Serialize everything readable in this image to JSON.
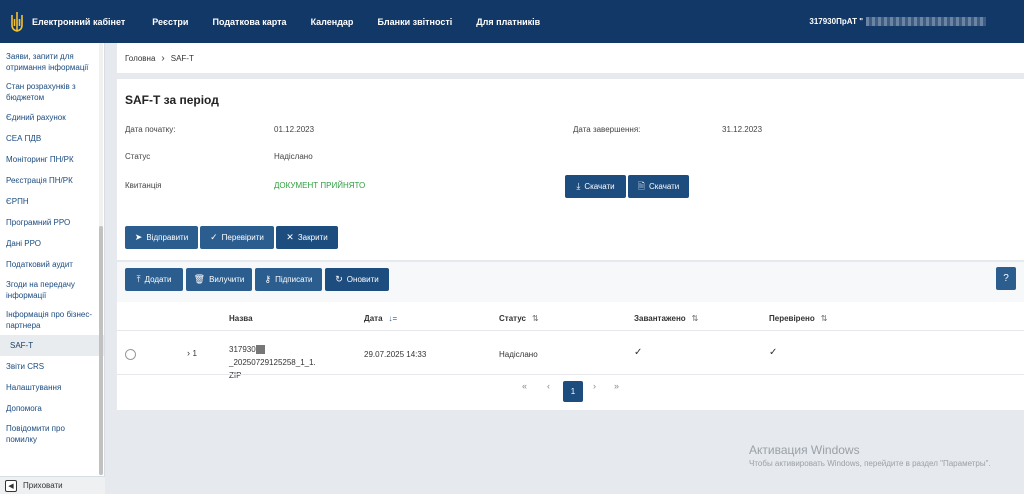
{
  "topbar": {
    "brand": "Електронний кабінет",
    "nav": [
      "Реєстри",
      "Податкова карта",
      "Календар",
      "Бланки звітності",
      "Для платників"
    ],
    "user": "317930",
    "user_suffix": "ПрАТ \""
  },
  "sidebar": {
    "items": [
      "Заяви, запити для отримання інформації",
      "Стан розрахунків з бюджетом",
      "Єдиний рахунок",
      "СЕА ПДВ",
      "Моніторинг ПН/РК",
      "Реєстрація ПН/РК",
      "ЄРПН",
      "Програмний РРО",
      "Дані РРО",
      "Податковий аудит",
      "Згоди на передачу інформації",
      "Інформація про бізнес-партнера",
      "SAF-T",
      "Звіти CRS",
      "Налаштування",
      "Допомога",
      "Повідомити про помилку"
    ],
    "active_item": "SAF-T",
    "hide_label": "Приховати"
  },
  "breadcrumb": {
    "home": "Головна",
    "current": "SAF-T"
  },
  "form": {
    "title": "SAF-T за період",
    "start_label": "Дата початку:",
    "start_value": "01.12.2023",
    "end_label": "Дата завершення:",
    "end_value": "31.12.2023",
    "status_label": "Статус",
    "status_value": "Надіслано",
    "receipt_label": "Квитанція",
    "receipt_value": "ДОКУМЕНТ ПРИЙНЯТО",
    "download1": "Скачати",
    "download2": "Скачати",
    "send": "Відправити",
    "check": "Перевірити",
    "close": "Закрити"
  },
  "grid": {
    "toolbar": {
      "add": "Додати",
      "delete": "Вилучити",
      "sign": "Підписати",
      "refresh": "Оновити",
      "help": "?"
    },
    "columns": [
      "Назва",
      "Дата",
      "Статус",
      "Завантажено",
      "Перевірено"
    ],
    "rows": [
      {
        "expander": "1",
        "name_prefix": "317930",
        "name_rest": "_20250729125258_1_1.",
        "name_ext": "ZIP",
        "date": "29.07.2025 14:33",
        "status": "Надіслано",
        "loaded": "✓",
        "checked": "✓"
      }
    ]
  },
  "pagination": {
    "first": "«",
    "prev": "‹",
    "current": "1",
    "next": "›",
    "last": "»"
  },
  "watermark": {
    "title": "Активация Windows",
    "subtitle": "Чтобы активировать Windows, перейдите в раздел \"Параметры\"."
  }
}
